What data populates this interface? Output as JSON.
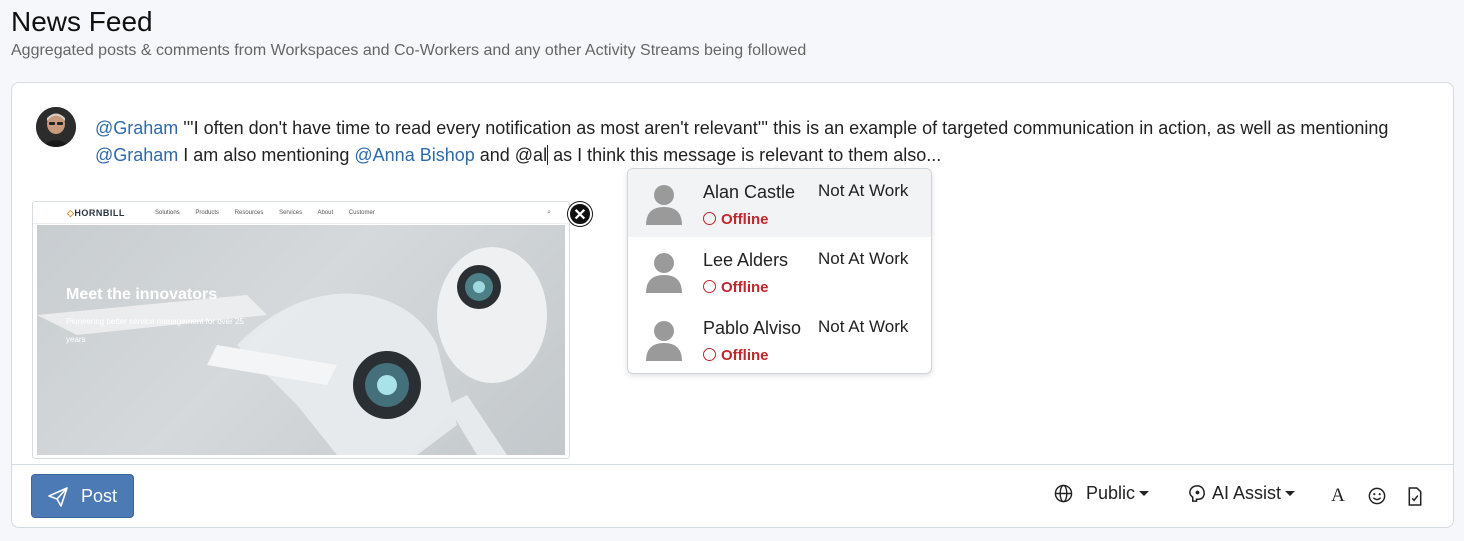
{
  "page": {
    "title": "News Feed",
    "subtitle": "Aggregated posts & comments from Workspaces and Co-Workers and any other Activity Streams being followed"
  },
  "composer": {
    "text_parts": {
      "m1": "@Graham",
      "t1": " '''I often don't have time to read every notification as most aren't relevant''' this is an example of targeted communication in action, as well as mentioning ",
      "m2": "@Graham",
      "t2": " I am also mentioning ",
      "m3": "@Anna Bishop",
      "t3": "  and @al",
      "t4": " as I think this message is relevant to them also..."
    },
    "link_preview": {
      "logo": "HORNBILL",
      "nav": [
        "Solutions",
        "Products",
        "Resources",
        "Services",
        "About",
        "Customer"
      ],
      "hero_title": "Meet the innovators",
      "hero_subtitle": "Pioneering better service management for over 25 years"
    },
    "remove_symbol": "✕"
  },
  "mention_suggestions": [
    {
      "name": "Alan Castle",
      "status": "Offline",
      "availability": "Not At Work",
      "active": true
    },
    {
      "name": "Lee Alders",
      "status": "Offline",
      "availability": "Not At Work",
      "active": false
    },
    {
      "name": "Pablo Alviso",
      "status": "Offline",
      "availability": "Not At Work",
      "active": false
    }
  ],
  "toolbar": {
    "post_label": "Post",
    "visibility_label": "Public",
    "ai_assist_label": "AI Assist",
    "font_icon_label": "A"
  },
  "colors": {
    "accent": "#4b7ab4",
    "mention": "#2f6aa8",
    "offline": "#c0262d"
  }
}
